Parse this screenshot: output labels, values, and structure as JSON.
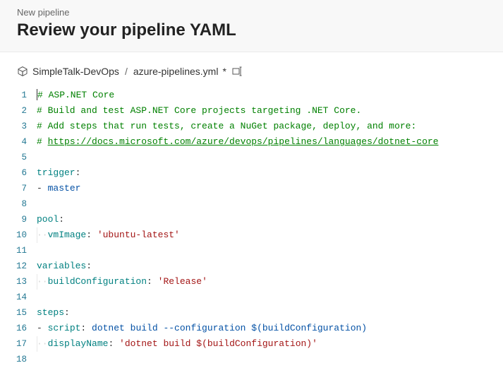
{
  "header": {
    "breadcrumb": "New pipeline",
    "title": "Review your pipeline YAML"
  },
  "fileBar": {
    "repo": "SimpleTalk-DevOps",
    "separator": "/",
    "filename": "azure-pipelines.yml",
    "dirtyMark": "*"
  },
  "editor": {
    "lines": [
      {
        "n": 1,
        "t": "comment",
        "caret": true,
        "text": "# ASP.NET Core"
      },
      {
        "n": 2,
        "t": "comment",
        "text": "# Build and test ASP.NET Core projects targeting .NET Core."
      },
      {
        "n": 3,
        "t": "comment",
        "text": "# Add steps that run tests, create a NuGet package, deploy, and more:"
      },
      {
        "n": 4,
        "t": "comment-link",
        "prefix": "# ",
        "link": "https://docs.microsoft.com/azure/devops/pipelines/languages/dotnet-core"
      },
      {
        "n": 5,
        "t": "blank"
      },
      {
        "n": 6,
        "t": "key",
        "key": "trigger",
        "colon": ":"
      },
      {
        "n": 7,
        "t": "list-plain",
        "dash": "- ",
        "value": "master"
      },
      {
        "n": 8,
        "t": "blank"
      },
      {
        "n": 9,
        "t": "key",
        "key": "pool",
        "colon": ":"
      },
      {
        "n": 10,
        "t": "indent-kv",
        "indent": "··",
        "key": "vmImage",
        "colon": ": ",
        "value": "'ubuntu-latest'"
      },
      {
        "n": 11,
        "t": "blank"
      },
      {
        "n": 12,
        "t": "key",
        "key": "variables",
        "colon": ":"
      },
      {
        "n": 13,
        "t": "indent-kv",
        "indent": "··",
        "key": "buildConfiguration",
        "colon": ": ",
        "value": "'Release'"
      },
      {
        "n": 14,
        "t": "blank"
      },
      {
        "n": 15,
        "t": "key",
        "key": "steps",
        "colon": ":"
      },
      {
        "n": 16,
        "t": "list-kv-plain",
        "dash": "- ",
        "key": "script",
        "colon": ": ",
        "value": "dotnet build --configuration $(buildConfiguration)"
      },
      {
        "n": 17,
        "t": "indent-kv",
        "indent": "··",
        "key": "displayName",
        "colon": ": ",
        "value": "'dotnet build $(buildConfiguration)'"
      },
      {
        "n": 18,
        "t": "blank"
      }
    ]
  }
}
